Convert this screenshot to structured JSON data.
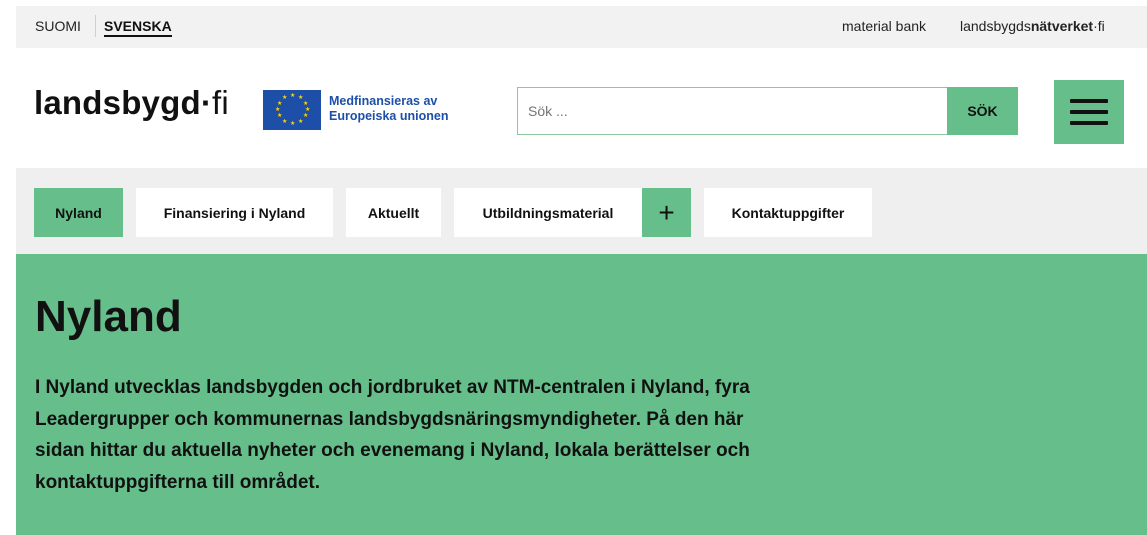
{
  "topbar": {
    "lang_fi": "SUOMI",
    "lang_sv": "SVENSKA",
    "material_bank": "material bank",
    "network_prefix": "landsbygds",
    "network_bold": "nätverket",
    "network_suffix": "·fi"
  },
  "header": {
    "logo_main": "landsbygd",
    "logo_dot": "·",
    "logo_tld": "fi",
    "eu_line1": "Medfinansieras av",
    "eu_line2": "Europeiska unionen",
    "search_placeholder": "Sök ...",
    "search_button": "SÖK"
  },
  "nav": {
    "items": [
      {
        "label": "Nyland",
        "active": true
      },
      {
        "label": "Finansiering i Nyland",
        "active": false
      },
      {
        "label": "Aktuellt",
        "active": false
      },
      {
        "label": "Utbildningsmaterial",
        "active": false
      },
      {
        "label": "Kontaktuppgifter",
        "active": false
      }
    ],
    "expand_symbol": "+"
  },
  "hero": {
    "title": "Nyland",
    "text": "I Nyland utvecklas landsbygden och jordbruket av NTM-centralen i Nyland, fyra Leadergrupper och kommunernas landsbygdsnäringsmyndigheter. På den här sidan hittar du aktuella nyheter och evenemang i Nyland, lokala berättelser och kontaktuppgifterna till området."
  },
  "colors": {
    "accent_green": "#66bf8b",
    "eu_blue": "#1d4fa8",
    "eu_star": "#ffd600",
    "topbar_bg": "#f2f2f2",
    "nav_bg": "#efefef"
  },
  "icons": {
    "menu": "hamburger-menu-icon",
    "eu_flag": "eu-flag-icon",
    "expand": "plus-icon"
  }
}
